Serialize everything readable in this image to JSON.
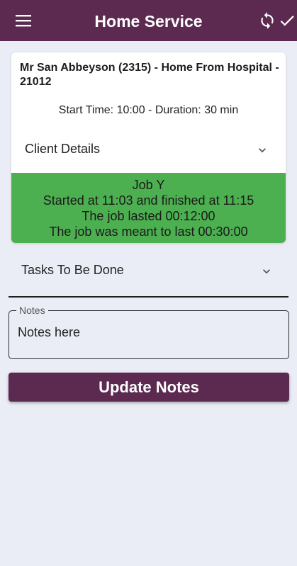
{
  "app_bar": {
    "title": "Home Service",
    "menu_icon": "hamburger-menu-icon",
    "sync_icon": "sync-icon",
    "check_icon": "check-icon"
  },
  "job": {
    "title": "Mr San Abbeyson (2315) - Home From Hospital - 21012",
    "times": "Start Time: 10:00 - Duration: 30 min",
    "client_details_label": "Client Details",
    "status_color": "#4caf50",
    "status_lines": [
      "Job Y",
      "Started at 11:03 and finished at 11:15",
      "The job lasted 00:12:00",
      "The job was meant to last 00:30:00"
    ]
  },
  "tasks": {
    "label": "Tasks To Be Done"
  },
  "notes": {
    "legend": "Notes",
    "value": "Notes here"
  },
  "update_button": {
    "label": "Update Notes"
  },
  "colors": {
    "primary": "#5c2a50",
    "background": "#eaedf5"
  }
}
